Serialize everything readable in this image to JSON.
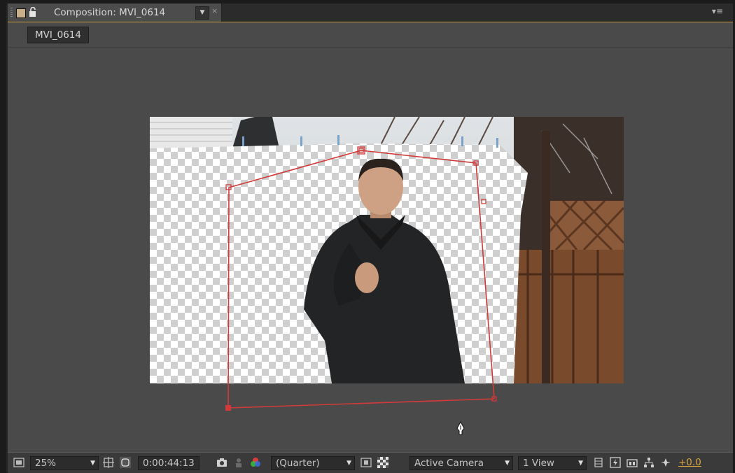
{
  "tab": {
    "title": "Composition: MVI_0614",
    "dropdown": "▼",
    "close": "×",
    "panel_menu": "▾≡"
  },
  "breadcrumb": {
    "comp_name": "MVI_0614"
  },
  "toolbar": {
    "magnification": "25%",
    "timecode": "0:00:44:13",
    "resolution": "(Quarter)",
    "camera": "Active Camera",
    "views": "1 View",
    "exposure": "+0.0",
    "dropdown_glyph": "▼"
  },
  "colors": {
    "panel_bg": "#4a4a4a",
    "tab_highlight": "#c89a3a",
    "mask_path": "#d23a3a",
    "exposure_accent": "#d9a441"
  },
  "icons": [
    "region-of-interest-icon",
    "toggle-mask-path-icon",
    "snapshot-icon",
    "show-snapshot-icon",
    "color-channel-icon",
    "fast-previews-icon",
    "transparency-grid-icon",
    "3d-view-icon",
    "flowchart-icon",
    "reset-exposure-icon"
  ]
}
